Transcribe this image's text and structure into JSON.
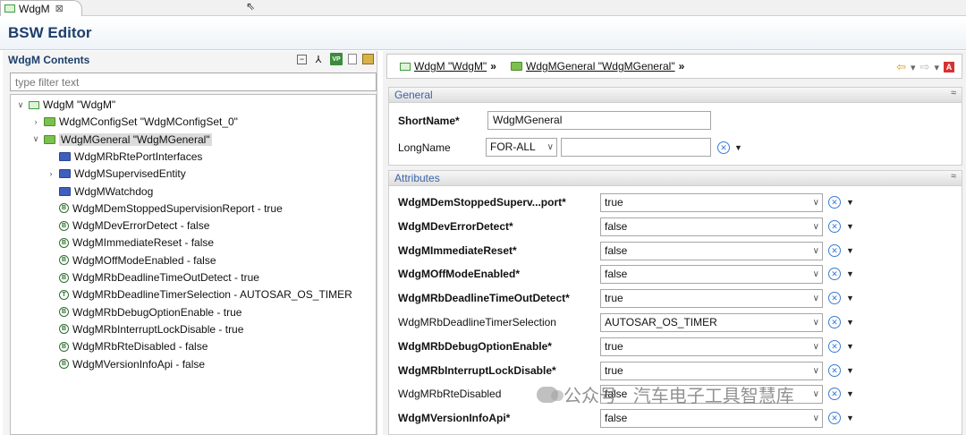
{
  "tab": {
    "label": "WdgM",
    "close": "⊠"
  },
  "editor": {
    "title": "BSW Editor"
  },
  "left": {
    "title": "WdgM Contents",
    "filter_placeholder": "type filter text",
    "tree": [
      {
        "label": "WdgM \"WdgM\"",
        "twisty": "∨",
        "icon": "module-icon"
      },
      {
        "label": "WdgMConfigSet \"WdgMConfigSet_0\"",
        "twisty": "›",
        "icon": "green-folder-icon"
      },
      {
        "label": "WdgMGeneral \"WdgMGeneral\"",
        "twisty": "∨",
        "icon": "green-folder-icon",
        "selected": true
      },
      {
        "label": "WdgMRbRtePortInterfaces",
        "twisty": "",
        "icon": "blue-folder-icon"
      },
      {
        "label": "WdgMSupervisedEntity",
        "twisty": "›",
        "icon": "blue-folder-icon"
      },
      {
        "label": "WdgMWatchdog",
        "twisty": "",
        "icon": "blue-folder-icon"
      },
      {
        "label": "WdgMDemStoppedSupervisionReport - true",
        "twisty": "",
        "icon": "boolean-param-icon",
        "glyph": "B"
      },
      {
        "label": "WdgMDevErrorDetect - false",
        "twisty": "",
        "icon": "boolean-param-icon",
        "glyph": "B"
      },
      {
        "label": "WdgMImmediateReset - false",
        "twisty": "",
        "icon": "boolean-param-icon",
        "glyph": "B"
      },
      {
        "label": "WdgMOffModeEnabled - false",
        "twisty": "",
        "icon": "boolean-param-icon",
        "glyph": "B"
      },
      {
        "label": "WdgMRbDeadlineTimeOutDetect - true",
        "twisty": "",
        "icon": "boolean-param-icon",
        "glyph": "B"
      },
      {
        "label": "WdgMRbDeadlineTimerSelection - AUTOSAR_OS_TIMER",
        "twisty": "",
        "icon": "enum-param-icon",
        "glyph": "T"
      },
      {
        "label": "WdgMRbDebugOptionEnable - true",
        "twisty": "",
        "icon": "boolean-param-icon",
        "glyph": "B"
      },
      {
        "label": "WdgMRbInterruptLockDisable - true",
        "twisty": "",
        "icon": "boolean-param-icon",
        "glyph": "B"
      },
      {
        "label": "WdgMRbRteDisabled - false",
        "twisty": "",
        "icon": "boolean-param-icon",
        "glyph": "B"
      },
      {
        "label": "WdgMVersionInfoApi - false",
        "twisty": "",
        "icon": "boolean-param-icon",
        "glyph": "B"
      }
    ]
  },
  "breadcrumb": {
    "items": [
      "WdgM \"WdgM\"",
      "WdgMGeneral \"WdgMGeneral\""
    ],
    "separator": "»"
  },
  "general": {
    "title": "General",
    "shortname_label": "ShortName*",
    "shortname_value": "WdgMGeneral",
    "longname_label": "LongName",
    "language_value": "FOR-ALL",
    "longname_value": ""
  },
  "attributes": {
    "title": "Attributes",
    "rows": [
      {
        "label": "WdgMDemStoppedSuperv...port*",
        "value": "true",
        "bold": true
      },
      {
        "label": "WdgMDevErrorDetect*",
        "value": "false",
        "bold": true
      },
      {
        "label": "WdgMImmediateReset*",
        "value": "false",
        "bold": true
      },
      {
        "label": "WdgMOffModeEnabled*",
        "value": "false",
        "bold": true
      },
      {
        "label": "WdgMRbDeadlineTimeOutDetect*",
        "value": "true",
        "bold": true
      },
      {
        "label": "WdgMRbDeadlineTimerSelection",
        "value": "AUTOSAR_OS_TIMER",
        "bold": false
      },
      {
        "label": "WdgMRbDebugOptionEnable*",
        "value": "true",
        "bold": true
      },
      {
        "label": "WdgMRbInterruptLockDisable*",
        "value": "true",
        "bold": true
      },
      {
        "label": "WdgMRbRteDisabled",
        "value": "false",
        "bold": false
      },
      {
        "label": "WdgMVersionInfoApi*",
        "value": "false",
        "bold": true
      }
    ]
  },
  "watermark": {
    "text": "公众号 · 汽车电子工具智慧库"
  },
  "colors": {
    "title_blue": "#1d3f6b",
    "section_blue": "#3a64a8",
    "green_folder": "#7cc04e",
    "blue_folder": "#3f5fbf"
  }
}
